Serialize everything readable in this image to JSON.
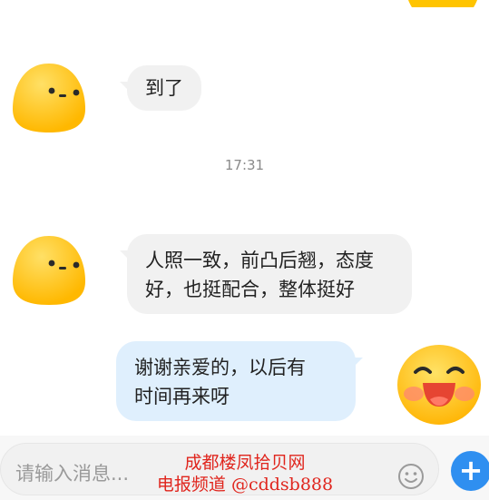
{
  "messages": [
    {
      "side": "left",
      "text": "到了",
      "avatar_icon": "neutral-face-icon"
    },
    {
      "side": "left",
      "text_lines": [
        "人照一致，前凸后翘，态度",
        "好，也挺配合，整体挺好"
      ],
      "avatar_icon": "neutral-face-icon"
    },
    {
      "side": "right",
      "text_lines": [
        "谢谢亲爱的，以后有",
        "时间再来呀"
      ],
      "avatar_icon": "laughing-face-icon"
    }
  ],
  "timestamp": "17:31",
  "input": {
    "placeholder": "请输入消息..."
  },
  "watermark": {
    "line1": "成都楼凤拾贝网",
    "line2": "电报频道 @cddsb888"
  },
  "colors": {
    "left_bubble": "#f1f1f1",
    "right_bubble": "#dfeffd",
    "send_button": "#2f8ff0",
    "watermark": "#e0251d",
    "avatar_yellow": "#ffc400"
  }
}
